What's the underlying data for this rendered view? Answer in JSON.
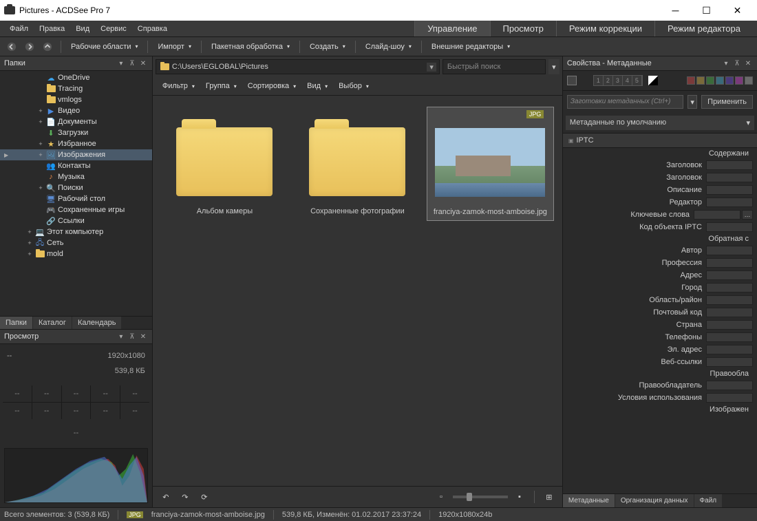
{
  "window": {
    "title": "Pictures - ACDSee Pro 7"
  },
  "menu": {
    "file": "Файл",
    "edit": "Правка",
    "view": "Вид",
    "service": "Сервис",
    "help": "Справка"
  },
  "modes": {
    "manage": "Управление",
    "view_mode": "Просмотр",
    "develop": "Режим коррекции",
    "edit": "Режим редактора"
  },
  "toolbar": {
    "workspaces": "Рабочие области",
    "import": "Импорт",
    "batch": "Пакетная обработка",
    "create": "Создать",
    "slideshow": "Слайд-шоу",
    "external": "Внешние редакторы"
  },
  "left": {
    "folders_title": "Папки",
    "tabs": {
      "folders": "Папки",
      "catalog": "Каталог",
      "calendar": "Календарь"
    },
    "preview_title": "Просмотр",
    "tree": [
      {
        "label": "OneDrive",
        "indent": 3,
        "icon": "cloud",
        "color": "#3aa0e8"
      },
      {
        "label": "Tracing",
        "indent": 3,
        "icon": "folder"
      },
      {
        "label": "vmlogs",
        "indent": 3,
        "icon": "folder"
      },
      {
        "label": "Видео",
        "indent": 3,
        "icon": "video",
        "color": "#4a8ae0",
        "exp": "+"
      },
      {
        "label": "Документы",
        "indent": 3,
        "icon": "doc",
        "color": "#e0e0e0",
        "exp": "+"
      },
      {
        "label": "Загрузки",
        "indent": 3,
        "icon": "download",
        "color": "#5ab05a"
      },
      {
        "label": "Избранное",
        "indent": 3,
        "icon": "star",
        "color": "#e8c05a",
        "exp": "+"
      },
      {
        "label": "Изображения",
        "indent": 3,
        "icon": "image",
        "color": "#5aa0d0",
        "sel": true,
        "exp": "+",
        "hasArrow": true
      },
      {
        "label": "Контакты",
        "indent": 3,
        "icon": "contacts",
        "color": "#c080c0"
      },
      {
        "label": "Музыка",
        "indent": 3,
        "icon": "music",
        "color": "#e88a4a"
      },
      {
        "label": "Поиски",
        "indent": 3,
        "icon": "search",
        "color": "#5aa0d0",
        "exp": "+"
      },
      {
        "label": "Рабочий стол",
        "indent": 3,
        "icon": "desktop",
        "color": "#5a8ad0"
      },
      {
        "label": "Сохраненные игры",
        "indent": 3,
        "icon": "games",
        "color": "#5ab090"
      },
      {
        "label": "Ссылки",
        "indent": 3,
        "icon": "link",
        "color": "#5a8ad0"
      },
      {
        "label": "Этот компьютер",
        "indent": 2,
        "icon": "computer",
        "color": "#5a8ad0",
        "exp": "+"
      },
      {
        "label": "Сеть",
        "indent": 2,
        "icon": "network",
        "color": "#5a8ad0",
        "exp": "+"
      },
      {
        "label": "mold",
        "indent": 2,
        "icon": "folder",
        "exp": "+"
      }
    ],
    "info": {
      "dash": "--",
      "dims": "1920x1080",
      "size": "539,8 КБ"
    }
  },
  "center": {
    "path": "C:\\Users\\EGLOBAL\\Pictures",
    "search_placeholder": "Быстрый поиск",
    "filters": {
      "filter": "Фильтр",
      "group": "Группа",
      "sort": "Сортировка",
      "view": "Вид",
      "select": "Выбор"
    },
    "thumbs": [
      {
        "name": "Альбом камеры",
        "type": "folder"
      },
      {
        "name": "Сохраненные фотографии",
        "type": "folder"
      },
      {
        "name": "franciya-zamok-most-amboise.jpg",
        "type": "jpg",
        "sel": true,
        "badge": "JPG"
      }
    ]
  },
  "right": {
    "title": "Свойства - Метаданные",
    "preset_placeholder": "Заготовки метаданных (Ctrl+)",
    "apply": "Применить",
    "default": "Метаданные по умолчанию",
    "section": "IPTC",
    "tabs": {
      "metadata": "Метаданные",
      "organization": "Организация данных",
      "file": "Файл"
    },
    "colors": [
      "#7a3a3a",
      "#7a6a3a",
      "#3a6a3a",
      "#3a6a7a",
      "#4a3a7a",
      "#7a3a7a",
      "#6a6a6a"
    ],
    "ratings": [
      "1",
      "2",
      "3",
      "4",
      "5"
    ],
    "fields": [
      {
        "label": "Содержани",
        "type": "header"
      },
      {
        "label": "Заголовок"
      },
      {
        "label": "Заголовок"
      },
      {
        "label": "Описание"
      },
      {
        "label": "Редактор"
      },
      {
        "label": "Ключевые слова",
        "dots": true
      },
      {
        "label": "Код объекта IPTC"
      },
      {
        "label": "Обратная с",
        "type": "header"
      },
      {
        "label": "Автор"
      },
      {
        "label": "Профессия"
      },
      {
        "label": "Адрес"
      },
      {
        "label": "Город"
      },
      {
        "label": "Область/район"
      },
      {
        "label": "Почтовый код"
      },
      {
        "label": "Страна"
      },
      {
        "label": "Телефоны"
      },
      {
        "label": "Эл. адрес"
      },
      {
        "label": "Веб-ссылки"
      },
      {
        "label": "Правообла",
        "type": "header"
      },
      {
        "label": "Правообладатель"
      },
      {
        "label": "Условия использования"
      },
      {
        "label": "Изображен",
        "type": "header"
      }
    ]
  },
  "status": {
    "total": "Всего элементов: 3  (539,8 КБ)",
    "badge": "JPG",
    "file": "franciya-zamok-most-amboise.jpg",
    "mod": "539,8 КБ, Изменён: 01.02.2017 23:37:24",
    "dims": "1920x1080x24b"
  }
}
